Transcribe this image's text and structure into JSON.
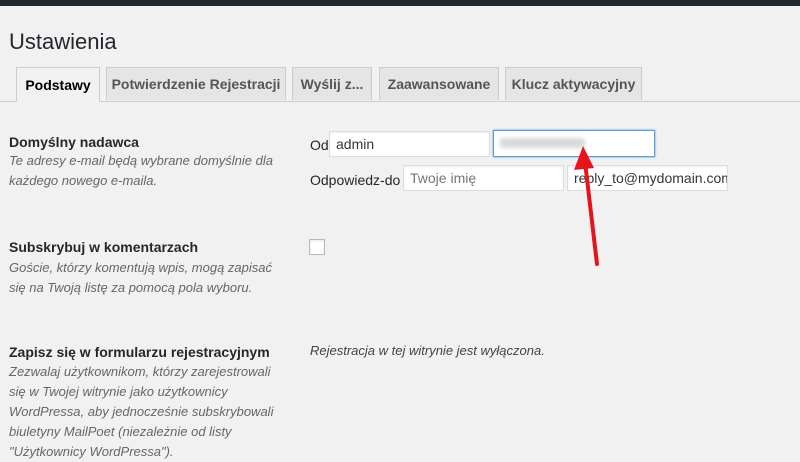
{
  "page": {
    "title": "Ustawienia"
  },
  "tabs": [
    {
      "label": "Podstawy",
      "active": true
    },
    {
      "label": "Potwierdzenie Rejestracji",
      "active": false
    },
    {
      "label": "Wyślij z...",
      "active": false
    },
    {
      "label": "Zaawansowane",
      "active": false
    },
    {
      "label": "Klucz aktywacyjny",
      "active": false
    }
  ],
  "sender": {
    "label": "Domyślny nadawca",
    "description_lines": [
      "Te adresy e-mail będą wybrane domyślnie dla",
      "każdego nowego e-maila."
    ],
    "from_label": "Od",
    "from_name_value": "admin",
    "reply_label": "Odpowiedz-do",
    "reply_name_placeholder": "Twoje imię",
    "reply_email_value": "reply_to@mydomain.com"
  },
  "subscribe_comments": {
    "label": "Subskrybuj w komentarzach",
    "description_lines": [
      "Goście, którzy komentują wpis, mogą zapisać",
      "się na Twoją listę za pomocą pola wyboru."
    ],
    "checked": false
  },
  "subscribe_registration": {
    "label": "Zapisz się w formularzu rejestracyjnym",
    "description_lines": [
      "Zezwalaj użytkownikom, którzy zarejestrowali",
      "się w Twojej witrynie jako użytkownicy",
      "WordPressa, aby jednocześnie subskrybowali",
      "biuletyny MailPoet (niezależnie od listy",
      "\"Użytkownicy WordPressa\")."
    ],
    "note": "Rejestracja w tej witrynie jest wyłączona."
  },
  "colors": {
    "background": "#f1f1f1",
    "annotation_arrow": "#e8141c",
    "focus_border": "#5b9dd9"
  }
}
